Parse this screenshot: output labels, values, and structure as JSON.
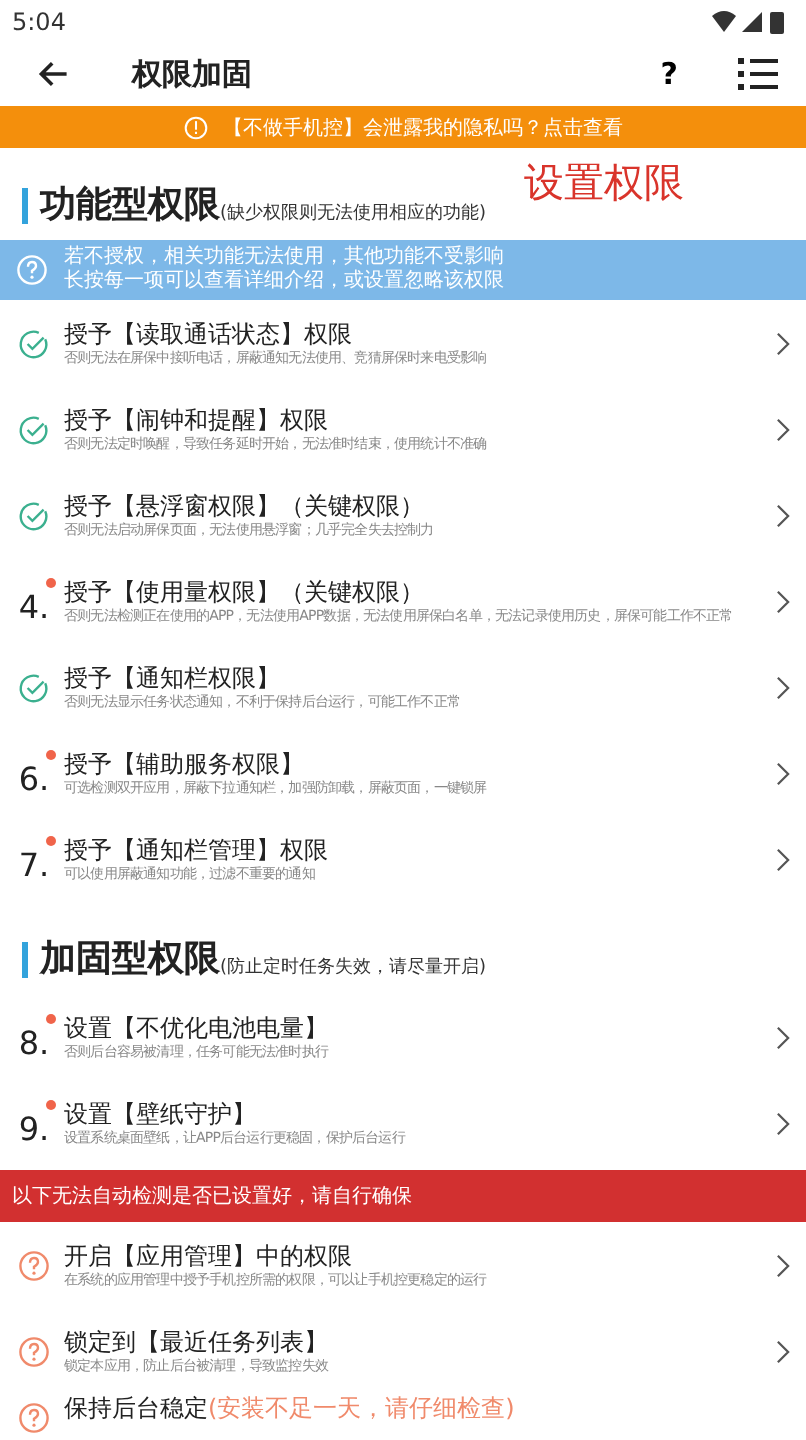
{
  "status_bar": {
    "time": "5:04"
  },
  "toolbar": {
    "title": "权限加固",
    "help": "?"
  },
  "notice": {
    "text": "【不做手机控】会泄露我的隐私吗？点击查看"
  },
  "overlay_caption": "设置权限",
  "sections": [
    {
      "title": "功能型权限",
      "subtitle": "(缺少权限则无法使用相应的功能)",
      "tip": [
        "若不授权，相关功能无法使用，其他功能不受影响",
        "长按每一项可以查看详细介绍，或设置忽略该权限"
      ],
      "items": [
        {
          "kind": "done",
          "title": "授予【读取通话状态】权限",
          "desc": "否则无法在屏保中接听电话，屏蔽通知无法使用、竞猜屏保时来电受影响"
        },
        {
          "kind": "done",
          "title": "授予【闹钟和提醒】权限",
          "desc": "否则无法定时唤醒，导致任务延时开始，无法准时结束，使用统计不准确"
        },
        {
          "kind": "done",
          "title": "授予【悬浮窗权限】（关键权限）",
          "desc": "否则无法启动屏保页面，无法使用悬浮窗；几乎完全失去控制力"
        },
        {
          "kind": "todo",
          "number": "4.",
          "title": "授予【使用量权限】（关键权限）",
          "desc": "否则无法检测正在使用的APP，无法使用APP数据，无法使用屏保白名单，无法记录使用历史，屏保可能工作不正常"
        },
        {
          "kind": "done",
          "title": "授予【通知栏权限】",
          "desc": "否则无法显示任务状态通知，不利于保持后台运行，可能工作不正常"
        },
        {
          "kind": "todo",
          "number": "6.",
          "title": "授予【辅助服务权限】",
          "desc": "可选检测双开应用，屏蔽下拉通知栏，加强防卸载，屏蔽页面，一键锁屏"
        },
        {
          "kind": "todo",
          "number": "7.",
          "title": "授予【通知栏管理】权限",
          "desc": "可以使用屏蔽通知功能，过滤不重要的通知"
        }
      ]
    },
    {
      "title": "加固型权限",
      "subtitle": "(防止定时任务失效，请尽量开启)",
      "items": [
        {
          "kind": "todo",
          "number": "8.",
          "title": "设置【不优化电池电量】",
          "desc": "否则后台容易被清理，任务可能无法准时执行"
        },
        {
          "kind": "todo",
          "number": "9.",
          "title": "设置【壁纸守护】",
          "desc": "设置系统桌面壁纸，让APP后台运行更稳固，保护后台运行"
        }
      ]
    }
  ],
  "warning": {
    "text": "以下无法自动检测是否已设置好，请自行确保"
  },
  "manual_items": [
    {
      "kind": "manual",
      "title": "开启【应用管理】中的权限",
      "desc": "在系统的应用管理中授予手机控所需的权限，可以让手机控更稳定的运行"
    },
    {
      "kind": "manual",
      "title": "锁定到【最近任务列表】",
      "desc": "锁定本应用，防止后台被清理，导致监控失效"
    },
    {
      "kind": "manual",
      "title": "保持后台稳定",
      "note": "(安装不足一天，请仔细检查)"
    }
  ]
}
